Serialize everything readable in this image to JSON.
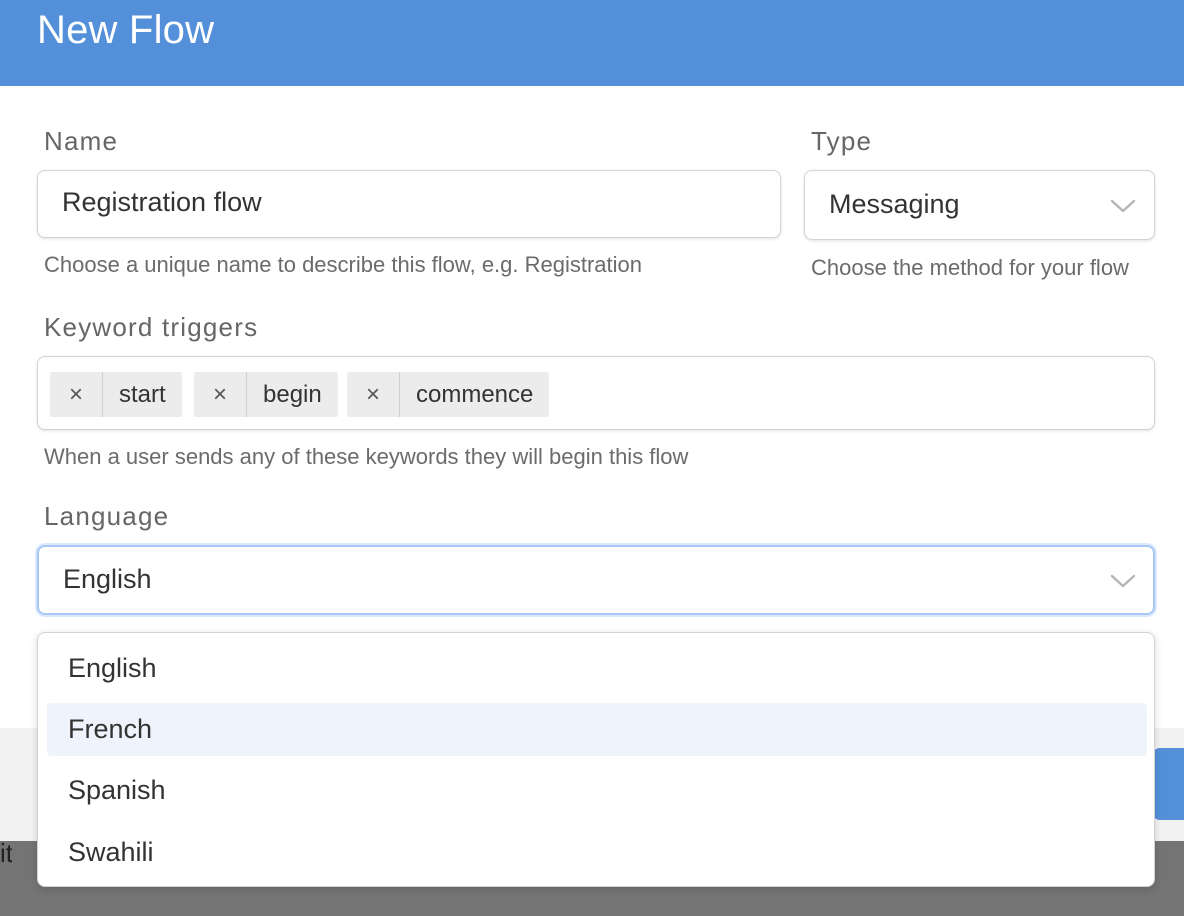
{
  "dialog": {
    "title": "New Flow"
  },
  "name_field": {
    "label": "Name",
    "value": "Registration flow",
    "help": "Choose a unique name to describe this flow, e.g. Registration"
  },
  "type_field": {
    "label": "Type",
    "value": "Messaging",
    "help": "Choose the method for your flow"
  },
  "keywords_field": {
    "label": "Keyword triggers",
    "remove_glyph": "×",
    "chips": [
      {
        "label": "start"
      },
      {
        "label": "begin"
      },
      {
        "label": "commence"
      }
    ],
    "help": "When a user sends any of these keywords they will begin this flow"
  },
  "language_field": {
    "label": "Language",
    "value": "English",
    "options": [
      "English",
      "French",
      "Spanish",
      "Swahili"
    ],
    "highlighted": "French"
  },
  "background": {
    "partial_text": "it"
  },
  "icons": {
    "chevron": "chevron-down-icon",
    "remove": "close-icon"
  },
  "colors": {
    "header": "#5390d9",
    "focus_border": "#a9c8f5",
    "highlight_row": "#eef3fc"
  }
}
